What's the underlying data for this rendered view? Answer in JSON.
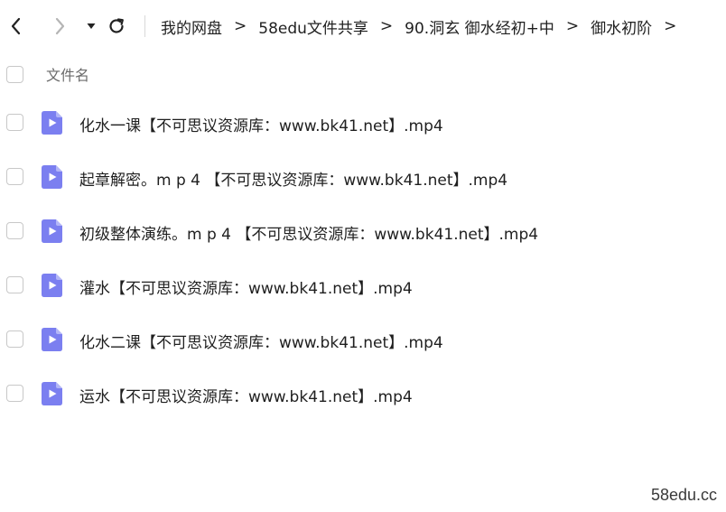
{
  "breadcrumb": {
    "items": [
      "我的网盘",
      "58edu文件共享",
      "90.洞玄 御水经初+中",
      "御水初阶"
    ],
    "separator": ">"
  },
  "list": {
    "header_label": "文件名",
    "files": [
      {
        "name": "化水一课【不可思议资源库：www.bk41.net】.mp4"
      },
      {
        "name": "起章解密。m p 4 【不可思议资源库：www.bk41.net】.mp4"
      },
      {
        "name": "初级整体演练。m p 4 【不可思议资源库：www.bk41.net】.mp4"
      },
      {
        "name": "灌水【不可思议资源库：www.bk41.net】.mp4"
      },
      {
        "name": "化水二课【不可思议资源库：www.bk41.net】.mp4"
      },
      {
        "name": "运水【不可思议资源库：www.bk41.net】.mp4"
      }
    ]
  },
  "icons": {
    "back": "chevron-left-icon",
    "forward": "chevron-right-icon",
    "dropdown": "caret-down-icon",
    "refresh": "refresh-icon",
    "file": "video-file-icon"
  },
  "colors": {
    "file_icon": "#7b7ff0",
    "file_icon_fold": "#b3b6f7"
  },
  "watermark": "58edu.cc"
}
